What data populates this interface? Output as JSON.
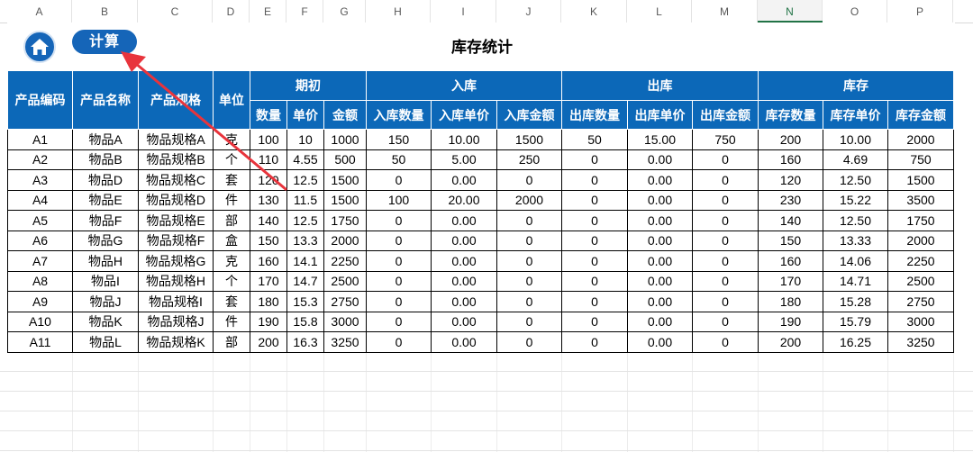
{
  "columns": [
    "A",
    "B",
    "C",
    "D",
    "E",
    "F",
    "G",
    "H",
    "I",
    "J",
    "K",
    "L",
    "M",
    "N",
    "O",
    "P"
  ],
  "selected_column": "N",
  "toolbar": {
    "calc_label": "计算",
    "home_icon": "home-icon"
  },
  "title": "库存统计",
  "headers": {
    "code": "产品编码",
    "name": "产品名称",
    "spec": "产品规格",
    "unit": "单位",
    "groups": [
      "期初",
      "入库",
      "出库",
      "库存"
    ],
    "sub": [
      "数量",
      "单价",
      "金额",
      "入库数量",
      "入库单价",
      "入库金额",
      "出库数量",
      "出库单价",
      "出库金额",
      "库存数量",
      "库存单价",
      "库存金额"
    ]
  },
  "rows": [
    [
      "A1",
      "物品A",
      "物品规格A",
      "克",
      "100",
      "10",
      "1000",
      "150",
      "10.00",
      "1500",
      "50",
      "15.00",
      "750",
      "200",
      "10.00",
      "2000"
    ],
    [
      "A2",
      "物品B",
      "物品规格B",
      "个",
      "110",
      "4.55",
      "500",
      "50",
      "5.00",
      "250",
      "0",
      "0.00",
      "0",
      "160",
      "4.69",
      "750"
    ],
    [
      "A3",
      "物品D",
      "物品规格C",
      "套",
      "120",
      "12.5",
      "1500",
      "0",
      "0.00",
      "0",
      "0",
      "0.00",
      "0",
      "120",
      "12.50",
      "1500"
    ],
    [
      "A4",
      "物品E",
      "物品规格D",
      "件",
      "130",
      "11.5",
      "1500",
      "100",
      "20.00",
      "2000",
      "0",
      "0.00",
      "0",
      "230",
      "15.22",
      "3500"
    ],
    [
      "A5",
      "物品F",
      "物品规格E",
      "部",
      "140",
      "12.5",
      "1750",
      "0",
      "0.00",
      "0",
      "0",
      "0.00",
      "0",
      "140",
      "12.50",
      "1750"
    ],
    [
      "A6",
      "物品G",
      "物品规格F",
      "盒",
      "150",
      "13.3",
      "2000",
      "0",
      "0.00",
      "0",
      "0",
      "0.00",
      "0",
      "150",
      "13.33",
      "2000"
    ],
    [
      "A7",
      "物品H",
      "物品规格G",
      "克",
      "160",
      "14.1",
      "2250",
      "0",
      "0.00",
      "0",
      "0",
      "0.00",
      "0",
      "160",
      "14.06",
      "2250"
    ],
    [
      "A8",
      "物品I",
      "物品规格H",
      "个",
      "170",
      "14.7",
      "2500",
      "0",
      "0.00",
      "0",
      "0",
      "0.00",
      "0",
      "170",
      "14.71",
      "2500"
    ],
    [
      "A9",
      "物品J",
      "物品规格I",
      "套",
      "180",
      "15.3",
      "2750",
      "0",
      "0.00",
      "0",
      "0",
      "0.00",
      "0",
      "180",
      "15.28",
      "2750"
    ],
    [
      "A10",
      "物品K",
      "物品规格J",
      "件",
      "190",
      "15.8",
      "3000",
      "0",
      "0.00",
      "0",
      "0",
      "0.00",
      "0",
      "190",
      "15.79",
      "3000"
    ],
    [
      "A11",
      "物品L",
      "物品规格K",
      "部",
      "200",
      "16.3",
      "3250",
      "0",
      "0.00",
      "0",
      "0",
      "0.00",
      "0",
      "200",
      "16.25",
      "3250"
    ]
  ],
  "colors": {
    "header_blue": "#0c68b8",
    "button_blue": "#1565b8",
    "arrow_red": "#e8343c",
    "excel_green": "#217346"
  }
}
